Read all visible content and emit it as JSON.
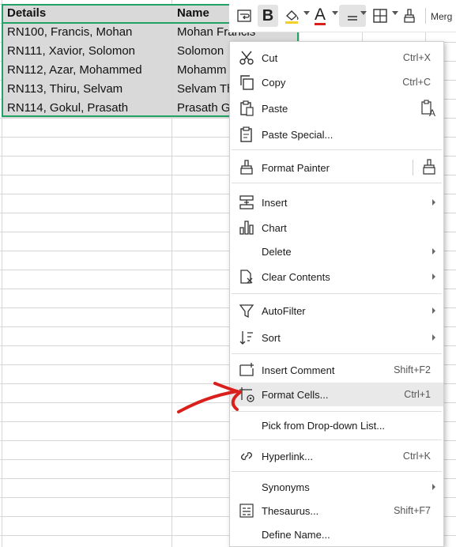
{
  "sheet": {
    "headers": [
      "Details",
      "Name"
    ],
    "rows": [
      [
        "RN100, Francis, Mohan",
        "Mohan Francis"
      ],
      [
        "RN111, Xavior, Solomon",
        "Solomon"
      ],
      [
        "RN112, Azar, Mohammed",
        "Mohamm"
      ],
      [
        "RN113, Thiru, Selvam",
        "Selvam Th"
      ],
      [
        "RN114, Gokul, Prasath",
        "Prasath G"
      ]
    ],
    "selection_color": "#21a366"
  },
  "toolbar": {
    "merge_label": "Merg",
    "bold_label": "B",
    "font_color_label": "A",
    "icons": [
      "wrap-text-icon",
      "bold-icon",
      "fill-color-icon",
      "font-color-icon",
      "align-icon",
      "borders-icon",
      "format-painter-icon"
    ]
  },
  "context_menu": {
    "items": [
      {
        "label": "Cut",
        "shortcut": "Ctrl+X",
        "icon": "scissors-icon"
      },
      {
        "label": "Copy",
        "shortcut": "Ctrl+C",
        "icon": "copy-icon"
      },
      {
        "label": "Paste",
        "shortcut": "",
        "icon": "paste-icon"
      },
      {
        "label": "Paste Special...",
        "shortcut": "",
        "icon": "paste-special-icon"
      },
      {
        "label": "Format Painter",
        "shortcut": "",
        "icon": "format-painter-icon"
      },
      {
        "label": "Insert",
        "shortcut": "",
        "icon": "insert-icon",
        "submenu": true
      },
      {
        "label": "Chart",
        "shortcut": "",
        "icon": "chart-icon"
      },
      {
        "label": "Delete",
        "shortcut": "",
        "icon": "",
        "submenu": true
      },
      {
        "label": "Clear Contents",
        "shortcut": "",
        "icon": "eraser-icon",
        "submenu": true
      },
      {
        "label": "AutoFilter",
        "shortcut": "",
        "icon": "filter-icon",
        "submenu": true
      },
      {
        "label": "Sort",
        "shortcut": "",
        "icon": "sort-icon",
        "submenu": true
      },
      {
        "label": "Insert Comment",
        "shortcut": "Shift+F2",
        "icon": "comment-icon"
      },
      {
        "label": "Format Cells...",
        "shortcut": "Ctrl+1",
        "icon": "format-cells-icon",
        "highlighted": true
      },
      {
        "label": "Pick from Drop-down List...",
        "shortcut": "",
        "icon": ""
      },
      {
        "label": "Hyperlink...",
        "shortcut": "Ctrl+K",
        "icon": "link-icon"
      },
      {
        "label": "Synonyms",
        "shortcut": "",
        "icon": "",
        "submenu": true
      },
      {
        "label": "Thesaurus...",
        "shortcut": "Shift+F7",
        "icon": "thesaurus-icon"
      },
      {
        "label": "Define Name...",
        "shortcut": "",
        "icon": ""
      }
    ]
  },
  "annotation": {
    "arrow_color": "#d9201c"
  }
}
